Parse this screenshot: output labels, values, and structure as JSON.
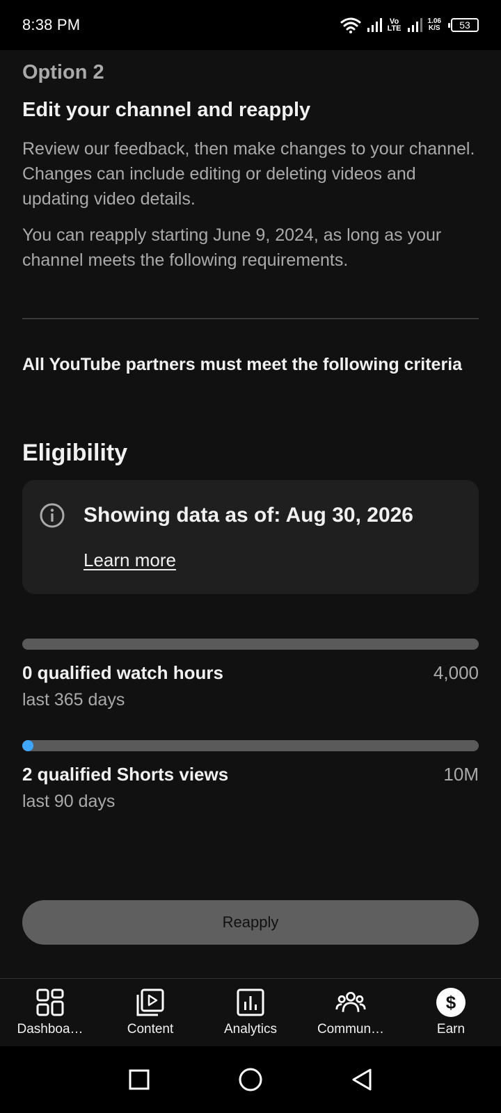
{
  "status_bar": {
    "time": "8:38 PM",
    "lte_top": "Vo",
    "lte_bottom": "LTE",
    "speed_top": "1.06",
    "speed_bottom": "K/S",
    "battery": "53"
  },
  "option": {
    "label": "Option 2",
    "title": "Edit your channel and reapply",
    "description": "Review our feedback, then make changes to your channel. Changes can include editing or deleting videos and updating video details.",
    "reapply_note": "You can reapply starting June 9, 2024, as long as your channel meets the following requirements."
  },
  "criteria_text": "All YouTube partners must meet the following criteria",
  "eligibility": {
    "heading": "Eligibility",
    "info_text": "Showing data as of: Aug 30, 2026",
    "learn_more": "Learn more"
  },
  "requirements": [
    {
      "title": "0 qualified watch hours",
      "target": "4,000",
      "period": "last 365 days",
      "progress": 0
    },
    {
      "title": "2 qualified Shorts views",
      "target": "10M",
      "period": "last 90 days",
      "progress": 2e-07
    }
  ],
  "reapply_button": "Reapply",
  "bottom_nav": [
    {
      "label": "Dashboa…",
      "icon": "dashboard-icon"
    },
    {
      "label": "Content",
      "icon": "content-icon"
    },
    {
      "label": "Analytics",
      "icon": "analytics-icon"
    },
    {
      "label": "Commun…",
      "icon": "community-icon"
    },
    {
      "label": "Earn",
      "icon": "earn-icon",
      "active": true
    }
  ],
  "colors": {
    "background": "#111111",
    "accent": "#3ea6ff",
    "card": "#1f1f1f",
    "secondary_text": "#aaaaaa"
  }
}
